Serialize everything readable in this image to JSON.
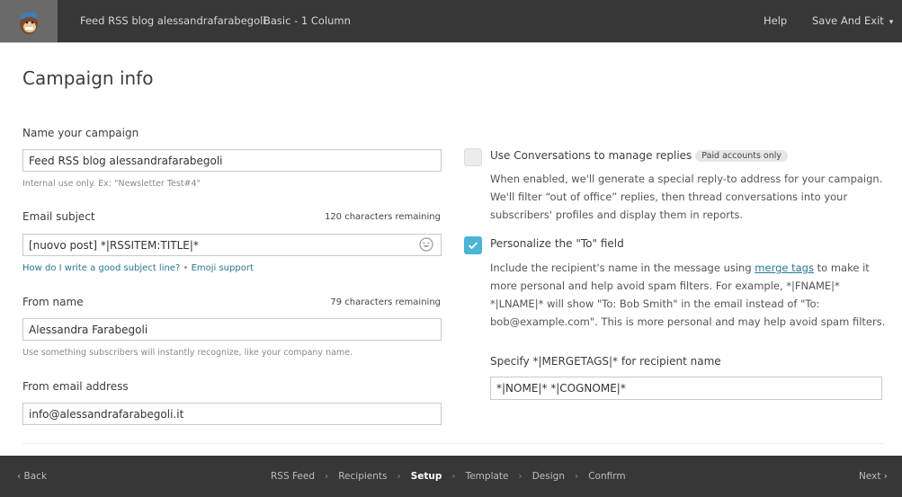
{
  "topbar": {
    "campaign_title": "Feed RSS blog alessandrafarabegoli",
    "template_name": "Basic - 1 Column",
    "help": "Help",
    "save_exit": "Save And Exit",
    "chevron": "⌄"
  },
  "page": {
    "title": "Campaign info"
  },
  "form": {
    "campaign_name": {
      "label": "Name your campaign",
      "value": "Feed RSS blog alessandrafarabegoli",
      "help": "Internal use only. Ex: \"Newsletter Test#4\""
    },
    "email_subject": {
      "label": "Email subject",
      "remaining": "120 characters remaining",
      "value": "[nuovo post] *|RSSITEM:TITLE|*",
      "link_subject": "How do I write a good subject line?",
      "link_sep": " • ",
      "link_emoji": "Emoji support"
    },
    "from_name": {
      "label": "From name",
      "remaining": "79 characters remaining",
      "value": "Alessandra Farabegoli",
      "help": "Use something subscribers will instantly recognize, like your company name."
    },
    "from_email": {
      "label": "From email address",
      "value": "info@alessandrafarabegoli.it"
    }
  },
  "options": {
    "conversations": {
      "label": "Use Conversations to manage replies",
      "badge": "Paid accounts only",
      "checked": false,
      "description": "When enabled, we'll generate a special reply-to address for your campaign. We'll filter “out of office” replies, then thread conversations into your subscribers' profiles and display them in reports."
    },
    "personalize": {
      "label": "Personalize the \"To\" field",
      "checked": true,
      "desc_before": "Include the recipient's name in the message using ",
      "desc_link": "merge tags",
      "desc_after": " to make it more personal and help avoid spam filters. For example, *|FNAME|* *|LNAME|* will show \"To: Bob Smith\" in the email instead of \"To: bob@example.com\". This is more personal and may help avoid spam filters.",
      "merge_label": "Specify *|MERGETAGS|* for recipient name",
      "merge_value": "*|NOME|* *|COGNOME|*"
    }
  },
  "footer": {
    "back": "‹  Back",
    "next": "Next  ›",
    "separator": "›",
    "steps": [
      {
        "label": "RSS Feed",
        "active": false
      },
      {
        "label": "Recipients",
        "active": false
      },
      {
        "label": "Setup",
        "active": true
      },
      {
        "label": "Template",
        "active": false
      },
      {
        "label": "Design",
        "active": false
      },
      {
        "label": "Confirm",
        "active": false
      }
    ]
  },
  "colors": {
    "accent": "#4cb4d6",
    "link": "#26758f",
    "bar": "#373737"
  }
}
